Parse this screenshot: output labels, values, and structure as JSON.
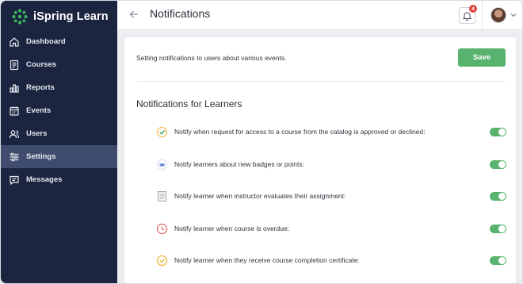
{
  "app": {
    "name": "iSpring Learn"
  },
  "sidebar": {
    "items": [
      {
        "label": "Dashboard",
        "icon": "home-icon",
        "active": false
      },
      {
        "label": "Courses",
        "icon": "courses-icon",
        "active": false
      },
      {
        "label": "Reports",
        "icon": "reports-icon",
        "active": false
      },
      {
        "label": "Events",
        "icon": "calendar-icon",
        "active": false
      },
      {
        "label": "Users",
        "icon": "users-icon",
        "active": false
      },
      {
        "label": "Settings",
        "icon": "settings-icon",
        "active": true
      },
      {
        "label": "Messages",
        "icon": "messages-icon",
        "active": false
      }
    ]
  },
  "header": {
    "title": "Notifications",
    "notification_count": "4"
  },
  "main": {
    "intro": "Setting notifications to users about various events.",
    "save_label": "Save",
    "section_title": "Notifications for Learners",
    "notifications": [
      {
        "label": "Notify when request for access to a course from the catalog is approved or declined:",
        "icon": "checkmark-circle-icon",
        "enabled": true
      },
      {
        "label": "Notify learners about new badges or points:",
        "icon": "crown-icon",
        "enabled": true
      },
      {
        "label": "Notify learner when instructor evaluates their assignment:",
        "icon": "document-icon",
        "enabled": true
      },
      {
        "label": "Notify learner when course is overdue:",
        "icon": "clock-icon",
        "enabled": true
      },
      {
        "label": "Notify learner when they receive course completion certificate:",
        "icon": "certificate-icon",
        "enabled": true
      }
    ]
  },
  "colors": {
    "sidebar_bg": "#1c2540",
    "sidebar_active": "#3f4c6e",
    "accent_green": "#59b36f",
    "badge_red": "#e0463e"
  }
}
